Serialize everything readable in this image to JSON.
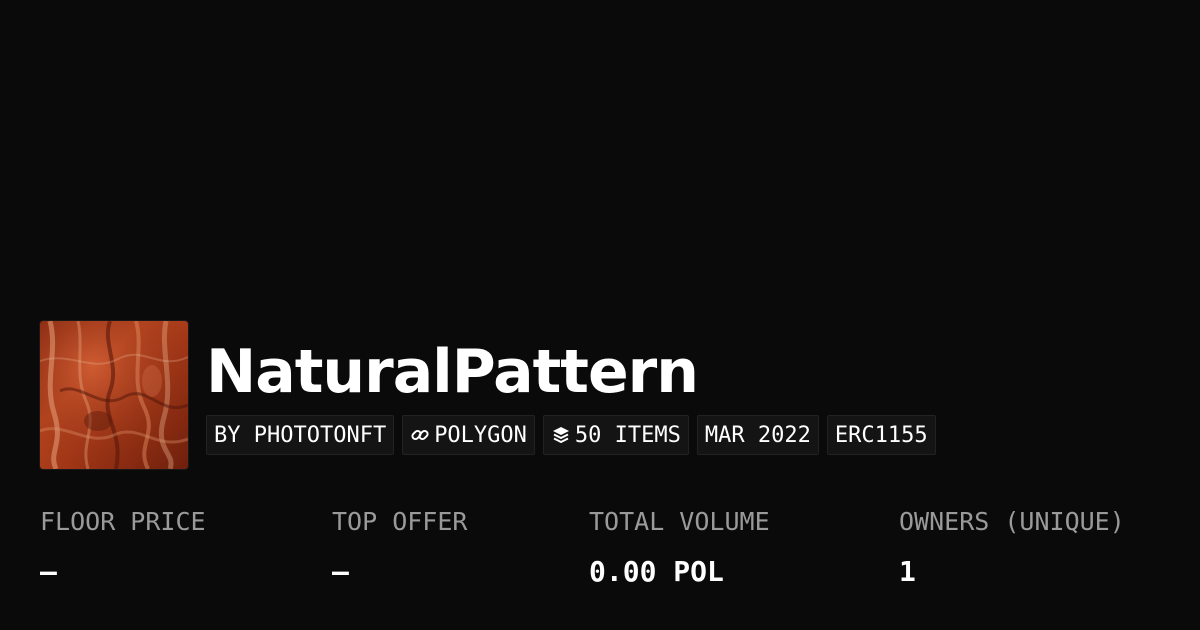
{
  "collection": {
    "name": "NaturalPattern",
    "avatar_icon": "natural-pattern-thumbnail"
  },
  "chips": {
    "creator": "BY PHOTOTONFT",
    "chain": "POLYGON",
    "chain_icon": "link-icon",
    "items": "50 ITEMS",
    "items_icon": "layers-icon",
    "date": "MAR 2022",
    "standard": "ERC1155"
  },
  "stats": {
    "floor_price": {
      "label": "FLOOR PRICE",
      "value": "–"
    },
    "top_offer": {
      "label": "TOP OFFER",
      "value": "–"
    },
    "total_volume": {
      "label": "TOTAL VOLUME",
      "value": "0.00 POL"
    },
    "owners": {
      "label": "OWNERS (UNIQUE)",
      "value": "1"
    }
  },
  "colors": {
    "background": "#0a0a0a",
    "chip_background": "#141414",
    "label": "#9a9a9a",
    "text": "#ffffff"
  }
}
